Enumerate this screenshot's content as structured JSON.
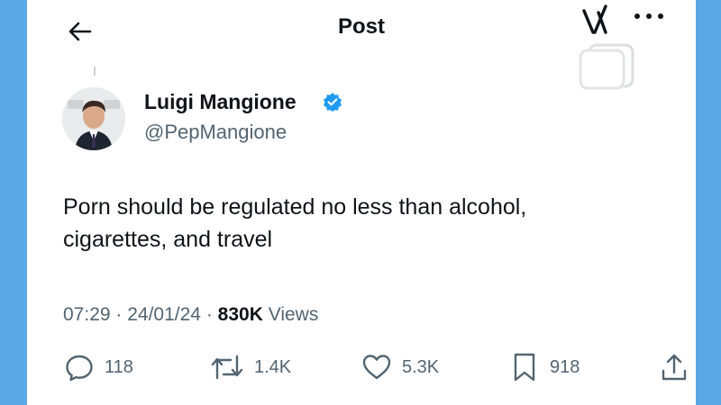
{
  "header": {
    "title": "Post"
  },
  "author": {
    "name": "Luigi Mangione",
    "handle": "@PepMangione",
    "verified": true
  },
  "tweet": {
    "lines": [
      "Porn should be regulated no less than alcohol,",
      "cigarettes, and travel"
    ],
    "time": "07:29",
    "date": "24/01/24",
    "views_count": "830K",
    "views_label": "Views"
  },
  "stats": {
    "replies": "118",
    "reposts": "1.4K",
    "likes": "5.3K",
    "bookmarks": "918"
  },
  "icons": {
    "back": "back-arrow-icon",
    "grok": "grok-icon",
    "more": "more-icon",
    "verified": "verified-badge-icon",
    "reply": "reply-icon",
    "repost": "repost-icon",
    "like": "heart-icon",
    "bookmark": "bookmark-icon",
    "share": "share-icon"
  },
  "colors": {
    "background": "#5aa9e6",
    "card": "#ffffff",
    "text": "#0f1419",
    "secondary": "#536471",
    "verified": "#1d9bf0"
  }
}
